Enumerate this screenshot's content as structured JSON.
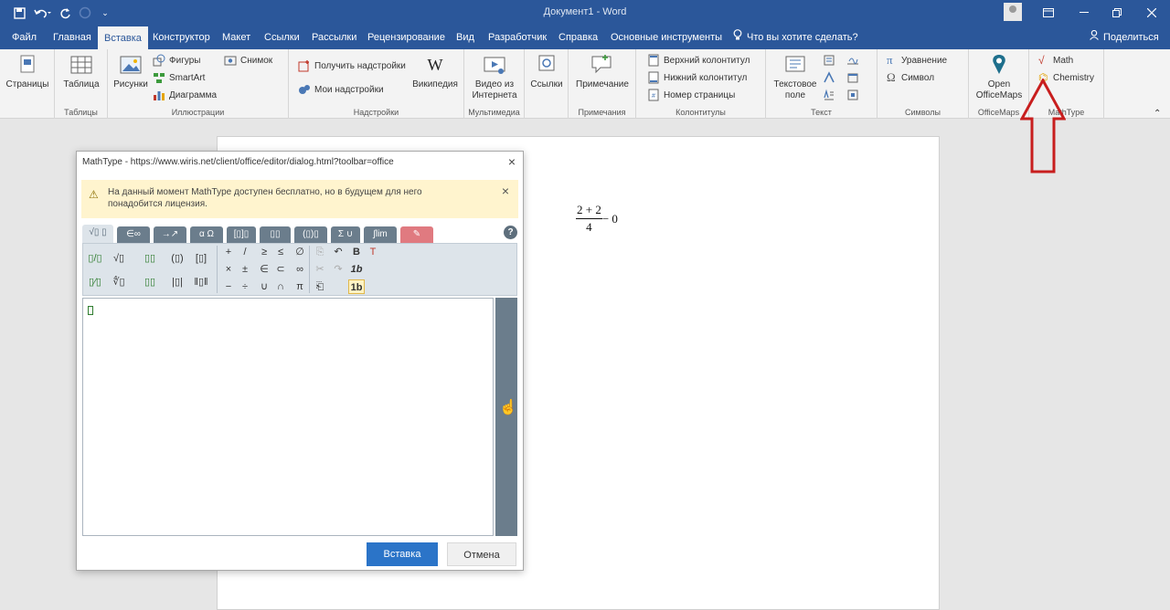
{
  "titlebar": {
    "doc_title": "Документ1 - Word",
    "qat_save": "🖫",
    "qat_undo": "↶",
    "qat_redo": "↻"
  },
  "tabs": [
    {
      "label": "Файл"
    },
    {
      "label": "Главная"
    },
    {
      "label": "Вставка"
    },
    {
      "label": "Конструктор"
    },
    {
      "label": "Макет"
    },
    {
      "label": "Ссылки"
    },
    {
      "label": "Рассылки"
    },
    {
      "label": "Рецензирование"
    },
    {
      "label": "Вид"
    },
    {
      "label": "Разработчик"
    },
    {
      "label": "Справка"
    },
    {
      "label": "Основные инструменты"
    }
  ],
  "tell_me": "Что вы хотите сделать?",
  "share": "Поделиться",
  "ribbon": {
    "pages": {
      "label": "Страницы"
    },
    "tables": {
      "btn": "Таблица",
      "group": "Таблицы"
    },
    "illustrations": {
      "pictures": "Рисунки",
      "shapes": "Фигуры",
      "smartart": "SmartArt",
      "chart": "Диаграмма",
      "screenshot": "Снимок",
      "group": "Иллюстрации"
    },
    "addins": {
      "get": "Получить надстройки",
      "my": "Мои надстройки",
      "wiki": "Википедия",
      "group": "Надстройки"
    },
    "media": {
      "video": "Видео из Интернета",
      "group": "Мультимедиа"
    },
    "links": {
      "btn": "Ссылки"
    },
    "comments": {
      "btn": "Примечание",
      "group": "Примечания"
    },
    "headfoot": {
      "header": "Верхний колонтитул",
      "footer": "Нижний колонтитул",
      "pagenum": "Номер страницы",
      "group": "Колонтитулы"
    },
    "text": {
      "textbox": "Текстовое поле",
      "group": "Текст"
    },
    "symbols": {
      "equation": "Уравнение",
      "symbol": "Символ",
      "group": "Символы"
    },
    "officemaps": {
      "btn": "Open OfficeMaps",
      "group": "OfficeMaps"
    },
    "mathtype": {
      "math": "Math",
      "chemistry": "Chemistry",
      "group": "MathType"
    }
  },
  "document": {
    "formula": {
      "num": "2 + 2",
      "den": "4",
      "rest": " − 0"
    }
  },
  "dialog": {
    "title": "MathType - https://www.wiris.net/client/office/editor/dialog.html?toolbar=office",
    "warning": "На данный момент MathType доступен бесплатно, но в будущем для него понадобится лицензия.",
    "tabs": [
      "√▯ ▯",
      "∈∞",
      "→↗",
      "α Ω",
      "[▯]▯",
      "▯▯",
      "(▯)▯",
      "Σ ∪",
      "∫lim",
      "✎"
    ],
    "help": "?",
    "toolbar": {
      "r1": [
        "▯/▯",
        "√▯",
        "▯▯",
        "(▯)",
        "[▯]"
      ],
      "r2": [
        "▯⁄▯",
        "∜▯",
        "▯▯",
        "|▯|",
        "‖▯‖"
      ],
      "ops1": [
        "+",
        "/",
        "≥",
        "≤",
        "∅"
      ],
      "ops2": [
        "×",
        "±",
        "∈",
        "⊂",
        "∞"
      ],
      "ops3": [
        "−",
        "÷",
        "∪",
        "∩",
        "π"
      ],
      "edit1": [
        "⎘",
        "↶",
        "B",
        "T"
      ],
      "edit2": [
        "✂",
        "↷",
        "1b"
      ],
      "edit3": [
        "⎗",
        "1b"
      ]
    },
    "insert": "Вставка",
    "cancel": "Отмена"
  }
}
